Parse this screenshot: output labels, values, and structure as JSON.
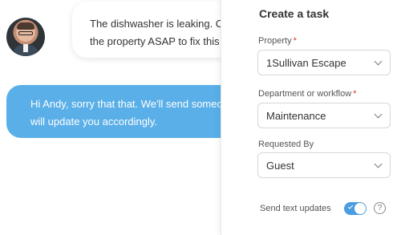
{
  "chat": {
    "incoming": {
      "line1": "The dishwasher is leaking. C",
      "line2": "the property ASAP to fix this"
    },
    "outgoing": {
      "line1": "Hi Andy, sorry that that. We'll send someo",
      "line2": "will update you accordingly."
    }
  },
  "task_panel": {
    "title": "Create a task",
    "property": {
      "label": "Property",
      "required_mark": "*",
      "value": "1Sullivan Escape"
    },
    "department": {
      "label": "Department or workflow",
      "required_mark": "*",
      "value": "Maintenance"
    },
    "requested_by": {
      "label": "Requested By",
      "value": "Guest"
    },
    "send_text_updates": {
      "label": "Send text updates",
      "enabled": true,
      "help_glyph": "?"
    }
  },
  "colors": {
    "outgoing_bubble": "#5aafe8",
    "toggle_on": "#4a9de0",
    "required": "#d33333"
  }
}
